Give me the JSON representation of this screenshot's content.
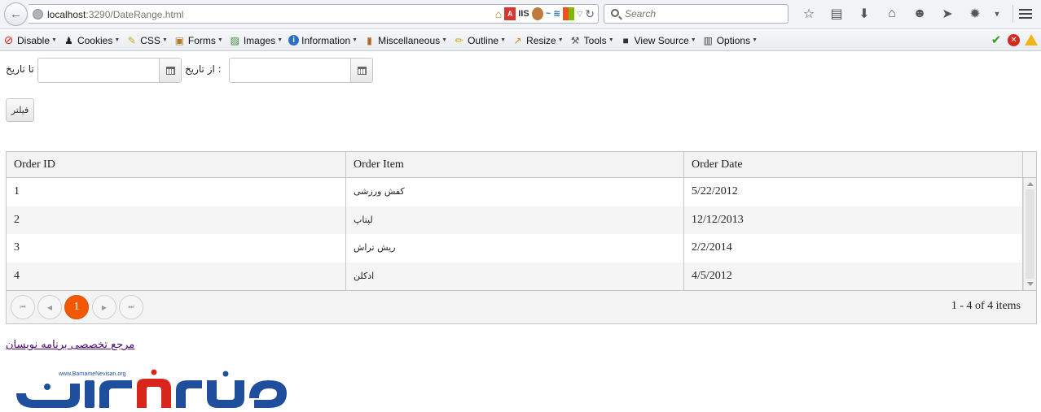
{
  "browser": {
    "url_host": "localhost",
    "url_path": ":3290/DateRange.html",
    "url_addon_label": "IIS",
    "search_placeholder": "Search"
  },
  "dev_toolbar": {
    "items": [
      "Disable",
      "Cookies",
      "CSS",
      "Forms",
      "Images",
      "Information",
      "Miscellaneous",
      "Outline",
      "Resize",
      "Tools",
      "View Source",
      "Options"
    ]
  },
  "filters": {
    "to_date_label": "تا تاریخ",
    "from_date_label": "از تاریخ :",
    "from_date_value": "",
    "to_date_value": "",
    "filter_button": "فیلتر"
  },
  "grid": {
    "columns": [
      "Order ID",
      "Order Item",
      "Order Date"
    ],
    "rows": [
      [
        "1",
        "کفش ورزشی",
        "5/22/2012"
      ],
      [
        "2",
        "لپتاپ",
        "12/12/2013"
      ],
      [
        "3",
        "ریش تراش",
        "2/2/2014"
      ],
      [
        "4",
        "ادکلن",
        "4/5/2012"
      ]
    ],
    "pager": {
      "current_page": "1",
      "info": "1 - 4 of 4 items"
    }
  },
  "footer": {
    "link_text": "مرجع تخصصی برنامه نویسان",
    "logo_url_text": "www.BarnameNevisan.org"
  },
  "colors": {
    "accent": "#f35800",
    "link": "#4b0a6e",
    "logo_blue": "#1f4f9c",
    "logo_red": "#d9261c"
  }
}
